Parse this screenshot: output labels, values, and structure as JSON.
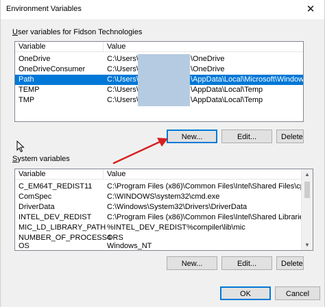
{
  "window": {
    "title": "Environment Variables",
    "close_glyph": "✕"
  },
  "user_group": {
    "label_prefix": "",
    "label_mnemonic": "U",
    "label_rest": "ser variables for Fidson Technologies",
    "columns": [
      "Variable",
      "Value"
    ],
    "rows": [
      {
        "variable": "OneDrive",
        "value": "C:\\Users\\F",
        "value_tail": "\\OneDrive",
        "selected": false
      },
      {
        "variable": "OneDriveConsumer",
        "value": "C:\\Users\\F",
        "value_tail": "\\OneDrive",
        "selected": false
      },
      {
        "variable": "Path",
        "value": "C:\\Users\\F",
        "value_tail": "\\AppData\\Local\\Microsoft\\Windows...",
        "selected": true
      },
      {
        "variable": "TEMP",
        "value": "C:\\Users\\F",
        "value_tail": "\\AppData\\Local\\Temp",
        "selected": false
      },
      {
        "variable": "TMP",
        "value": "C:\\Users\\F",
        "value_tail": "\\AppData\\Local\\Temp",
        "selected": false
      }
    ],
    "buttons": {
      "new": "New...",
      "edit": "Edit...",
      "delete": "Delete"
    }
  },
  "system_group": {
    "label_prefix": "",
    "label_mnemonic": "S",
    "label_rest": "ystem variables",
    "columns": [
      "Variable",
      "Value"
    ],
    "rows": [
      {
        "variable": "C_EM64T_REDIST11",
        "value": "C:\\Program Files (x86)\\Common Files\\Intel\\Shared Files\\cpp\\"
      },
      {
        "variable": "ComSpec",
        "value": "C:\\WINDOWS\\system32\\cmd.exe"
      },
      {
        "variable": "DriverData",
        "value": "C:\\Windows\\System32\\Drivers\\DriverData"
      },
      {
        "variable": "INTEL_DEV_REDIST",
        "value": "C:\\Program Files (x86)\\Common Files\\Intel\\Shared Libraries\\"
      },
      {
        "variable": "MIC_LD_LIBRARY_PATH",
        "value": "%INTEL_DEV_REDIST%compiler\\lib\\mic"
      },
      {
        "variable": "NUMBER_OF_PROCESSORS",
        "value": "4"
      },
      {
        "variable": "OS",
        "value": "Windows_NT"
      }
    ],
    "buttons": {
      "new": "New...",
      "edit": "Edit...",
      "delete": "Delete"
    }
  },
  "dialog_buttons": {
    "ok": "OK",
    "cancel": "Cancel"
  },
  "colors": {
    "selection": "#0078d7",
    "arrow": "#d62020",
    "redaction": "#b5cbe1"
  },
  "icons": {
    "close": "close-icon",
    "cursor": "mouse-pointer-icon",
    "annotation": "red-arrow-annotation"
  }
}
